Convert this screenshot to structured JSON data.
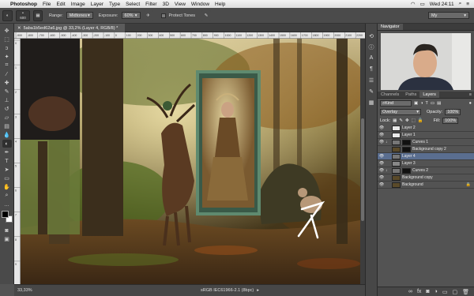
{
  "menubar": {
    "app": "Photoshop",
    "items": [
      "File",
      "Edit",
      "Image",
      "Layer",
      "Type",
      "Select",
      "Filter",
      "3D",
      "View",
      "Window",
      "Help"
    ],
    "clock": "Wed 24:11"
  },
  "options": {
    "brush_size": "600",
    "range_label": "Range:",
    "range_value": "Midtones",
    "exposure_label": "Exposure:",
    "exposure_value": "60%",
    "protect_tones": "Protect Tones",
    "workspace": "My"
  },
  "document": {
    "tab_title": "5aba1b5ed62a6.jpg @ 33,2% (Layer 4, RGB/8) *",
    "zoom": "33,33%",
    "profile": "sRGB IEC61966-2.1 (8bpc)"
  },
  "rulers": {
    "top": [
      "-900",
      "-800",
      "-700",
      "-600",
      "-500",
      "-400",
      "-300",
      "-200",
      "-100",
      "0",
      "100",
      "200",
      "300",
      "400",
      "500",
      "600",
      "700",
      "800",
      "900",
      "1000",
      "1100",
      "1200",
      "1300",
      "1400",
      "1500",
      "1600",
      "1700",
      "1800",
      "1900",
      "2000",
      "2100",
      "2200"
    ],
    "left": [
      "0",
      "1",
      "2",
      "3",
      "4",
      "5",
      "6",
      "7",
      "8",
      "9"
    ]
  },
  "navigator": {
    "tab": "Navigator"
  },
  "layers_panel": {
    "tabs": [
      "Channels",
      "Paths",
      "Layers"
    ],
    "active_tab": "Layers",
    "filter_kind": "Kind",
    "blend_mode": "Overlay",
    "opacity_label": "Opacity:",
    "opacity_value": "100%",
    "lock_label": "Lock:",
    "fill_label": "Fill:",
    "fill_value": "100%",
    "layers": [
      {
        "name": "Layer 2",
        "selected": false
      },
      {
        "name": "Layer 1",
        "selected": false
      },
      {
        "name": "Curves 1",
        "selected": false
      },
      {
        "name": "Background copy 2",
        "selected": false
      },
      {
        "name": "Layer 4",
        "selected": true
      },
      {
        "name": "Layer 3",
        "selected": false
      },
      {
        "name": "Curves 2",
        "selected": false
      },
      {
        "name": "Background copy",
        "selected": false
      },
      {
        "name": "Background",
        "selected": false
      }
    ]
  },
  "colors": {
    "selected_layer": "#5a6e90",
    "panel_bg": "#535353"
  }
}
